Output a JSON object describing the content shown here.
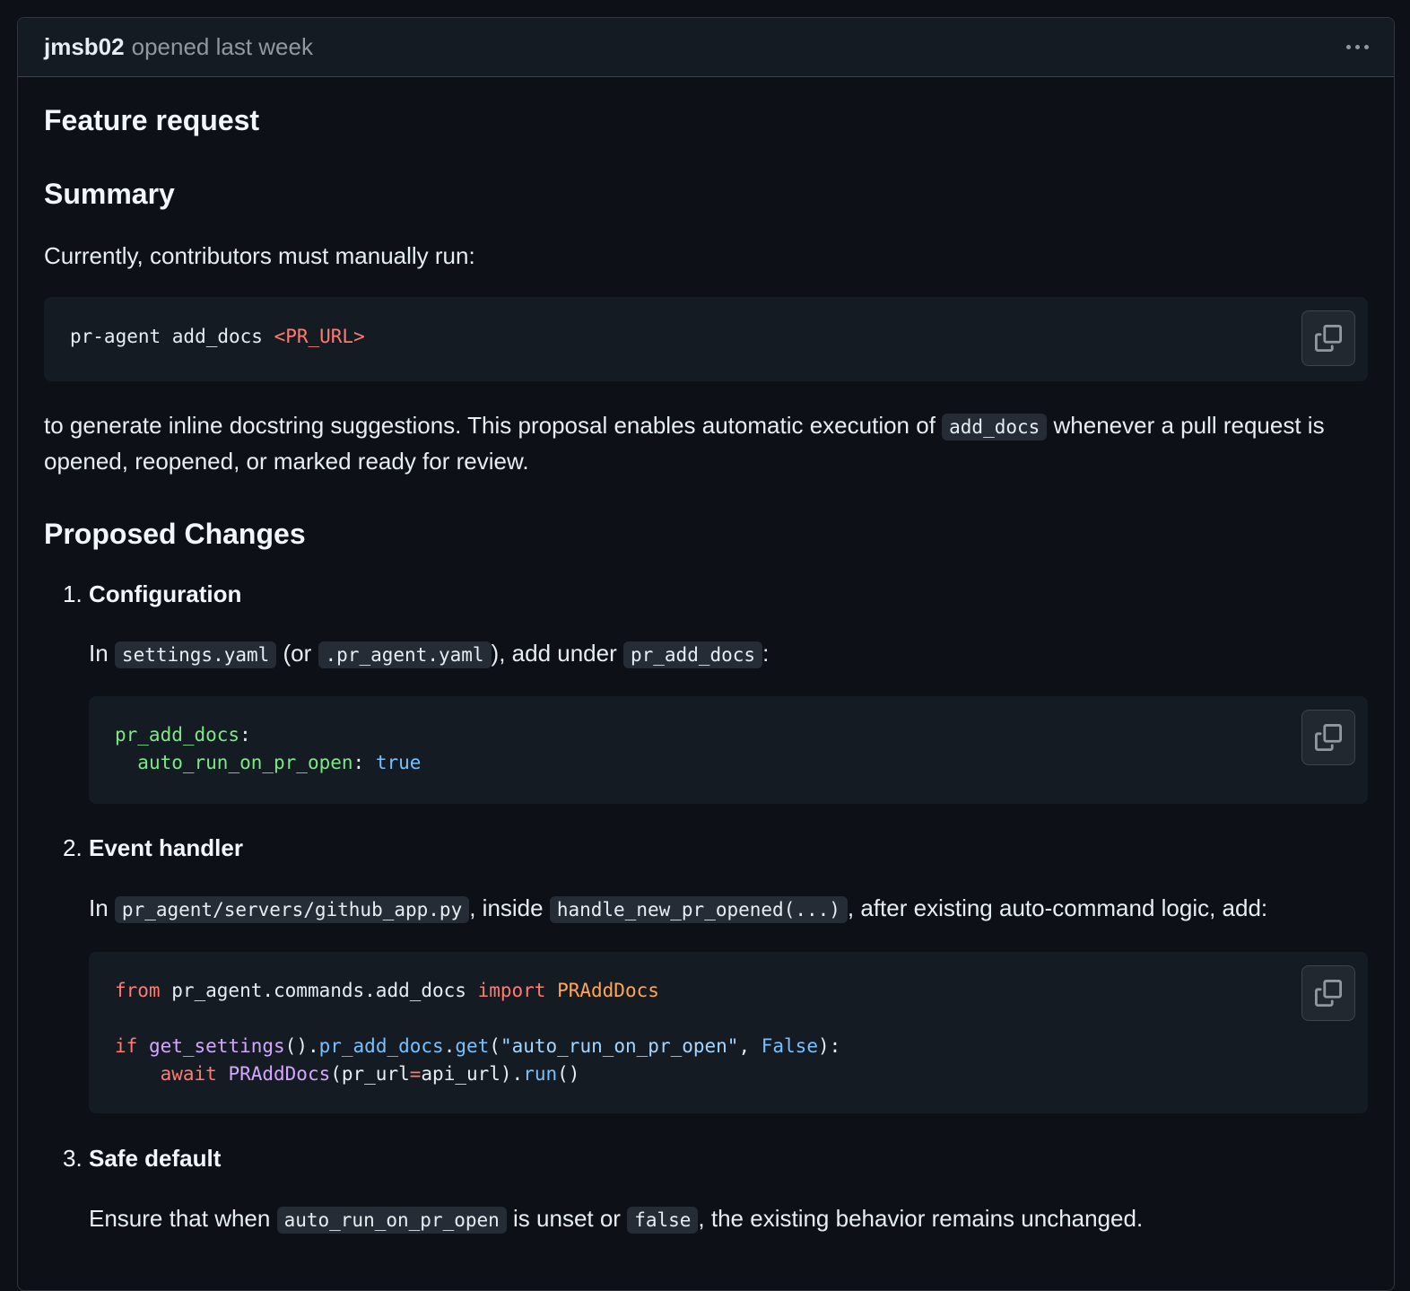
{
  "header": {
    "author": "jmsb02",
    "opened": "opened last week"
  },
  "body": {
    "title": "Feature request",
    "summary_heading": "Summary",
    "currently": "Currently, contributors must manually run:",
    "cmd": {
      "p1": "pr-agent add_docs ",
      "p2": "<PR_URL>"
    },
    "desc": {
      "t1": "to generate inline docstring suggestions. This proposal enables automatic execution of ",
      "code": "add_docs",
      "t2": " whenever a pull request is opened, reopened, or marked ready for review."
    },
    "proposed_heading": "Proposed Changes",
    "items": [
      {
        "num": "1.",
        "title": "Configuration",
        "t1": "In ",
        "c1": "settings.yaml",
        "t2": " (or ",
        "c2": ".pr_agent.yaml",
        "t3": "), add under ",
        "c3": "pr_add_docs",
        "t4": ":",
        "code": {
          "l1_key": "pr_add_docs",
          "l1_colon": ":",
          "l2_indent": "  ",
          "l2_key": "auto_run_on_pr_open",
          "l2_colon": ": ",
          "l2_val": "true"
        }
      },
      {
        "num": "2.",
        "title": "Event handler",
        "t1": "In ",
        "c1": "pr_agent/servers/github_app.py",
        "t2": ", inside ",
        "c2": "handle_new_pr_opened(...)",
        "t3": ", after existing auto-command logic, add:",
        "code": {
          "from": "from",
          "module": " pr_agent.commands.add_docs ",
          "import": "import",
          "cls": " PRAddDocs",
          "if": "if",
          "get_settings": " get_settings",
          "paren1": "().",
          "attr": "pr_add_docs",
          "dot": ".",
          "get": "get",
          "open": "(",
          "str": "\"auto_run_on_pr_open\"",
          "comma": ", ",
          "false": "False",
          "close": "):",
          "indent": "    ",
          "await": "await",
          "cls2": " PRAddDocs",
          "args": "(pr_url",
          "eq": "=",
          "args2": "api_url).",
          "run": "run",
          "end": "()"
        }
      },
      {
        "num": "3.",
        "title": "Safe default",
        "t1": "Ensure that when ",
        "c1": "auto_run_on_pr_open",
        "t2": " is unset or ",
        "c2": "false",
        "t3": ", the existing behavior remains unchanged."
      }
    ]
  },
  "icons": {
    "more": "kebab-horizontal-icon",
    "copy": "copy-icon"
  }
}
